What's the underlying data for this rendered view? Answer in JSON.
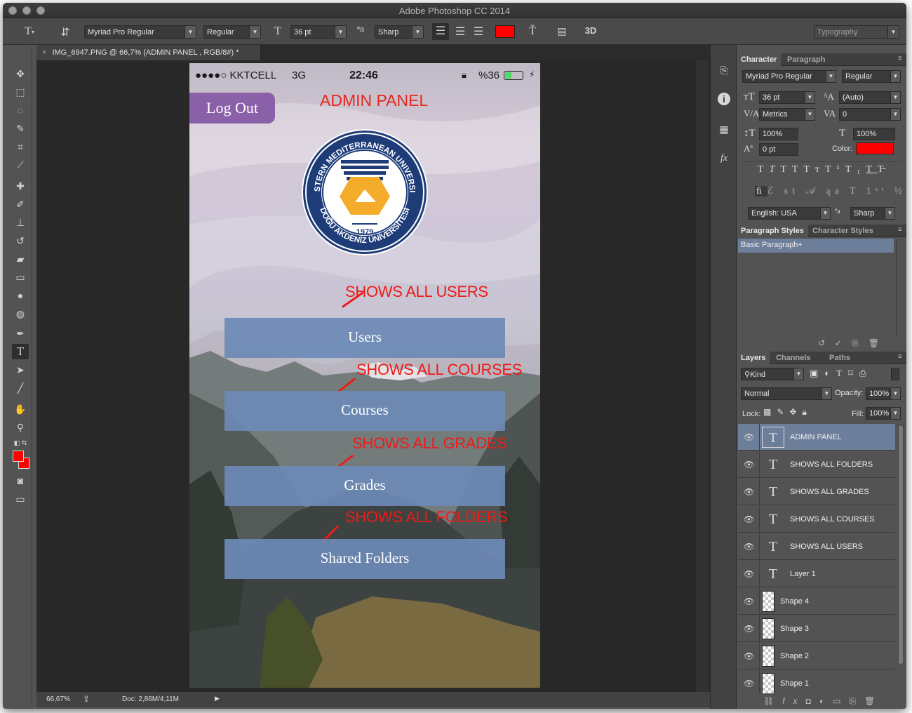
{
  "app": {
    "title": "Adobe Photoshop CC 2014",
    "workspace": "Typography"
  },
  "options_bar": {
    "font_family": "Myriad Pro Regular",
    "font_style": "Regular",
    "font_size": "36 pt",
    "antialias": "Sharp",
    "text_color": "#ff0000",
    "threed_label": "3D"
  },
  "document": {
    "tab_title": "IMG_6947.PNG @ 66,7% (ADMIN PANEL , RGB/8#) *",
    "zoom": "66,67%",
    "doc_size": "Doc: 2,86M/4,11M"
  },
  "phone": {
    "carrier": "●●●●○ KKTCELL",
    "network": "3G",
    "time": "22:46",
    "battery": "%36",
    "logout_label": "Log Out",
    "admin_label": "ADMIN PANEL",
    "seal": {
      "top_text": "EASTERN MEDITERRANEAN UNIVERSITY",
      "bottom_text": "DOĞU AKDENİZ ÜNİVERSİTESİ",
      "year": "1979"
    },
    "menu": [
      {
        "label": "Users",
        "annotation": "SHOWS ALL USERS"
      },
      {
        "label": "Courses",
        "annotation": "SHOWS ALL COURSES"
      },
      {
        "label": "Grades",
        "annotation": "SHOWS ALL GRADES"
      },
      {
        "label": "Shared Folders",
        "annotation": "SHOWS ALL FOLDERS"
      }
    ]
  },
  "character_panel": {
    "tabs": [
      "Character",
      "Paragraph"
    ],
    "font_family": "Myriad Pro Regular",
    "font_style": "Regular",
    "size": "36 pt",
    "leading": "(Auto)",
    "kerning": "Metrics",
    "tracking": "0",
    "vscale": "100%",
    "hscale": "100%",
    "baseline": "0 pt",
    "color_label": "Color:",
    "color": "#ff0000",
    "language": "English: USA",
    "antialias": "Sharp"
  },
  "styles_panel": {
    "tabs": [
      "Paragraph Styles",
      "Character Styles"
    ],
    "items": [
      "Basic Paragraph+"
    ]
  },
  "layers_panel": {
    "tabs": [
      "Layers",
      "Channels",
      "Paths"
    ],
    "filter": "Kind",
    "blend_mode": "Normal",
    "opacity_label": "Opacity:",
    "opacity": "100%",
    "lock_label": "Lock:",
    "fill_label": "Fill:",
    "fill": "100%",
    "layers": [
      {
        "name": "ADMIN PANEL",
        "type": "text",
        "selected": true
      },
      {
        "name": "SHOWS ALL FOLDERS",
        "type": "text"
      },
      {
        "name": "SHOWS ALL GRADES",
        "type": "text"
      },
      {
        "name": "SHOWS ALL COURSES",
        "type": "text"
      },
      {
        "name": "SHOWS ALL USERS",
        "type": "text"
      },
      {
        "name": "Layer 1",
        "type": "text"
      },
      {
        "name": "Shape 4",
        "type": "shape"
      },
      {
        "name": "Shape 3",
        "type": "shape"
      },
      {
        "name": "Shape 2",
        "type": "shape"
      },
      {
        "name": "Shape 1",
        "type": "shape"
      }
    ]
  }
}
